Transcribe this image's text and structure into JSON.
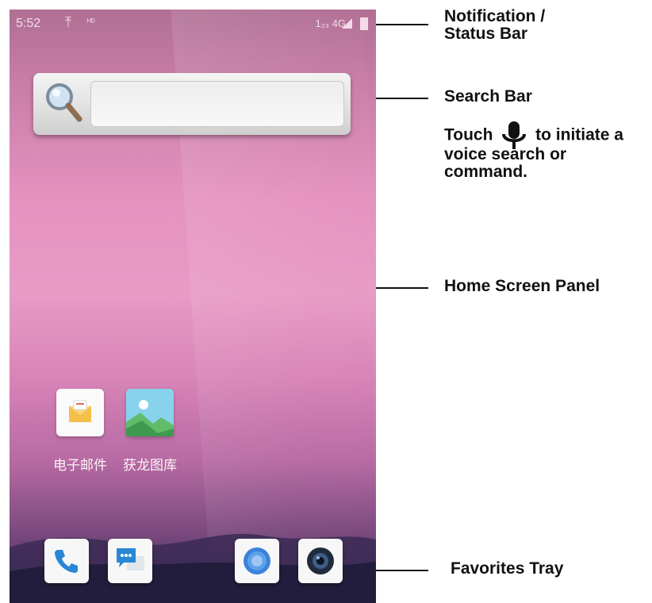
{
  "status_bar": {
    "time": "5:52",
    "upload_glyph": "⤒",
    "small_text": "ᴴᴰ",
    "right_text": "1₂₃ 4G"
  },
  "apps": [
    {
      "label": "电子邮件",
      "icon": "email-icon"
    },
    {
      "label": "获龙图库",
      "icon": "gallery-icon"
    }
  ],
  "favorites": [
    {
      "icon": "phone-icon"
    },
    {
      "icon": "messages-icon"
    },
    {
      "icon": "browser-icon"
    },
    {
      "icon": "camera-icon"
    }
  ],
  "callouts": {
    "notification_line1": "Notification /",
    "notification_line2": "Status Bar",
    "search_bar": "Search Bar",
    "touch_word": "Touch",
    "touch_rest": "to initiate a",
    "voice_line2": "voice search or",
    "voice_line3": "command.",
    "home_screen_panel": "Home Screen Panel",
    "favorites_tray": "Favorites Tray"
  },
  "colors": {
    "wallpaper_top": "#b06f93",
    "wallpaper_mid": "#e592bf",
    "wallpaper_bottom": "#2c2349"
  }
}
